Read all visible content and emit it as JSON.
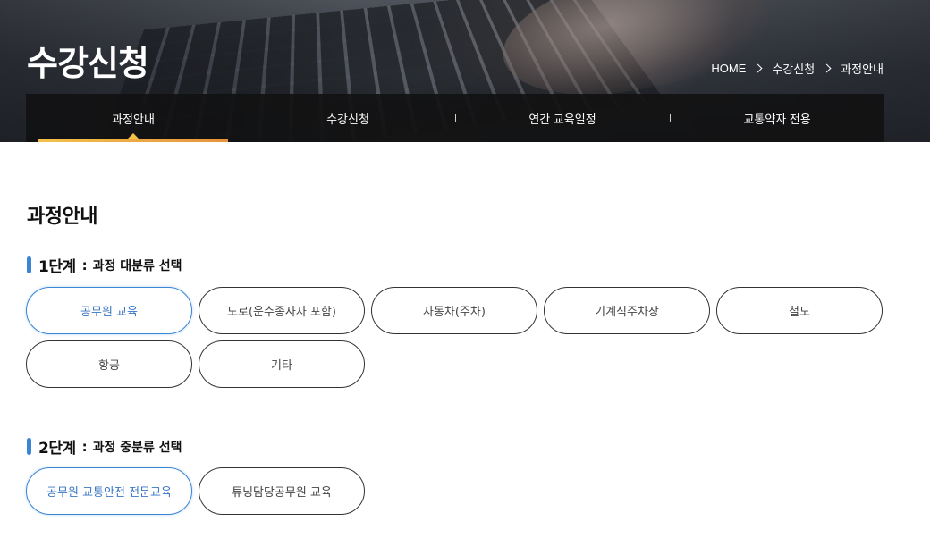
{
  "hero": {
    "title": "수강신청",
    "breadcrumb": [
      "HOME",
      "수강신청",
      "과정안내"
    ]
  },
  "tabs": [
    {
      "label": "과정안내",
      "active": true
    },
    {
      "label": "수강신청",
      "active": false
    },
    {
      "label": "연간 교육일정",
      "active": false
    },
    {
      "label": "교통약자 전용",
      "active": false
    }
  ],
  "page": {
    "title": "과정안내"
  },
  "step1": {
    "num": "1단계",
    "colon": ":",
    "desc": "과정 대분류 선택",
    "options": [
      "공무원 교육",
      "도로(운수종사자 포함)",
      "자동차(주차)",
      "기계식주차장",
      "철도",
      "항공",
      "기타"
    ],
    "selected_index": 0
  },
  "step2": {
    "num": "2단계",
    "colon": ":",
    "desc": "과정 중분류 선택",
    "options": [
      "공무원 교통안전 전문교육",
      "튜닝담당공무원 교육"
    ],
    "selected_index": 0
  },
  "colors": {
    "accent_blue": "#3a86d4",
    "tab_underline_start": "#f2c24a",
    "tab_underline_end": "#e8923c",
    "tabbar_bg": "#121214"
  }
}
